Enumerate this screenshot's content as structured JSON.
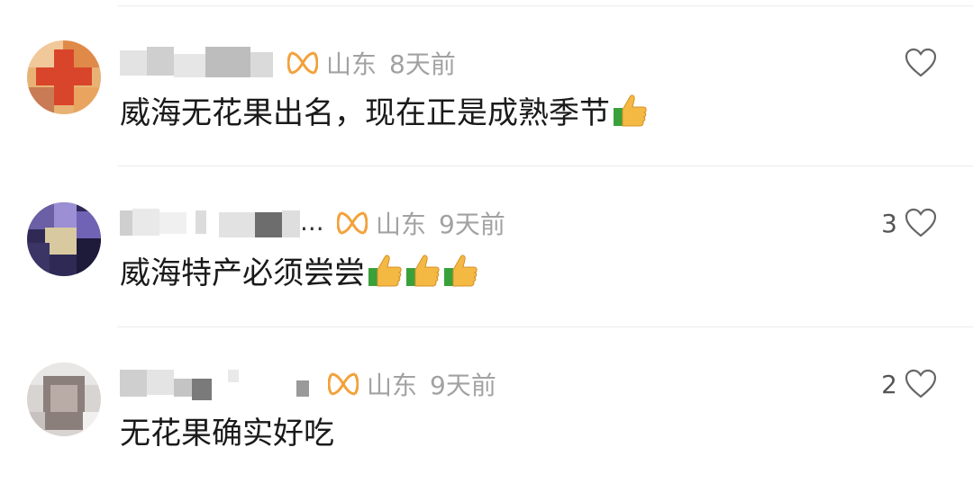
{
  "comments": [
    {
      "location": "山东",
      "time": "8天前",
      "text": "威海无花果出名，现在正是成熟季节",
      "thumbs": 1,
      "likes": "",
      "badge_icon": "vip-badge-icon",
      "like_icon": "heart-outline-icon"
    },
    {
      "location": "山东",
      "time": "9天前",
      "text": "威海特产必须尝尝",
      "thumbs": 3,
      "likes": "3",
      "name_suffix": "...",
      "badge_icon": "vip-badge-icon",
      "like_icon": "heart-outline-icon"
    },
    {
      "location": "山东",
      "time": "9天前",
      "text": "无花果确实好吃",
      "thumbs": 0,
      "likes": "2",
      "badge_icon": "vip-badge-icon",
      "like_icon": "heart-outline-icon"
    }
  ],
  "colors": {
    "badge": "#f2a13a",
    "meta_text": "#a2a2a2",
    "body_text": "#1a1a1a",
    "divider": "#ececec"
  }
}
